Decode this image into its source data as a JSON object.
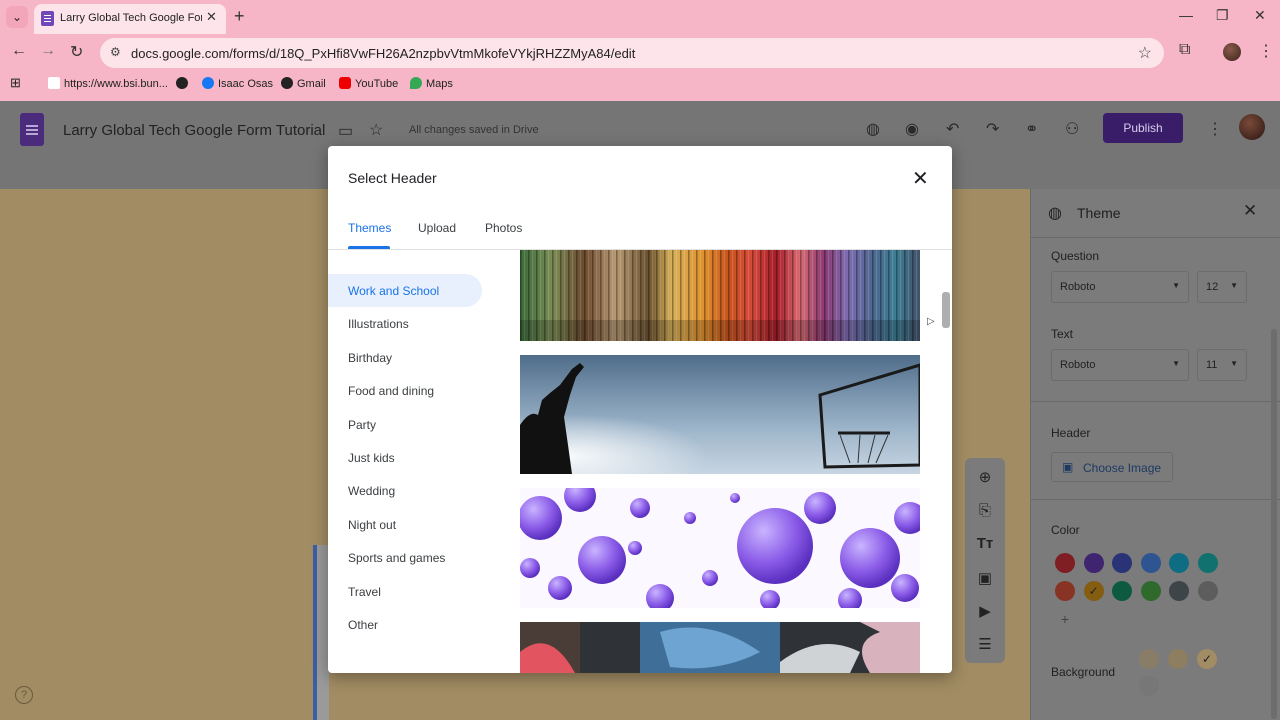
{
  "browser": {
    "tab_title": "Larry Global Tech Google Form",
    "url": "docs.google.com/forms/d/18Q_PxHfi8VwFH26A2nzpbvVtmMkofeVYkjRHZZMyA84/edit",
    "bookmarks": [
      "https://www.bsi.bun...",
      "Isaac Osas",
      "Gmail",
      "YouTube",
      "Maps"
    ]
  },
  "forms": {
    "title": "Larry Global Tech Google Form Tutorial",
    "saved_status": "All changes saved in Drive",
    "publish_label": "Publish"
  },
  "dialog": {
    "title": "Select Header",
    "tabs": [
      "Themes",
      "Upload",
      "Photos"
    ],
    "categories": [
      "Work and School",
      "Illustrations",
      "Birthday",
      "Food and dining",
      "Party",
      "Just kids",
      "Wedding",
      "Night out",
      "Sports and games",
      "Travel",
      "Other"
    ],
    "selected_category": "Work and School"
  },
  "theme_panel": {
    "title": "Theme",
    "question_label": "Question",
    "question_font": "Roboto",
    "question_size": "12",
    "text_label": "Text",
    "text_font": "Roboto",
    "text_size": "11",
    "header_label": "Header",
    "choose_image_label": "Choose Image",
    "color_label": "Color",
    "background_label": "Background",
    "colors": [
      "#7f1f24",
      "#3f2470",
      "#2a3376",
      "#2f5492",
      "#0f6d83",
      "#11716f",
      "#883323",
      "#855d10",
      "#0d5a40",
      "#2f6a2c",
      "#3e4548",
      "#5d5d5d"
    ],
    "selected_color": "#855d10",
    "backgrounds": [
      "#8a7d68",
      "#8c7e5e",
      "#a18c63",
      "#777777"
    ]
  }
}
